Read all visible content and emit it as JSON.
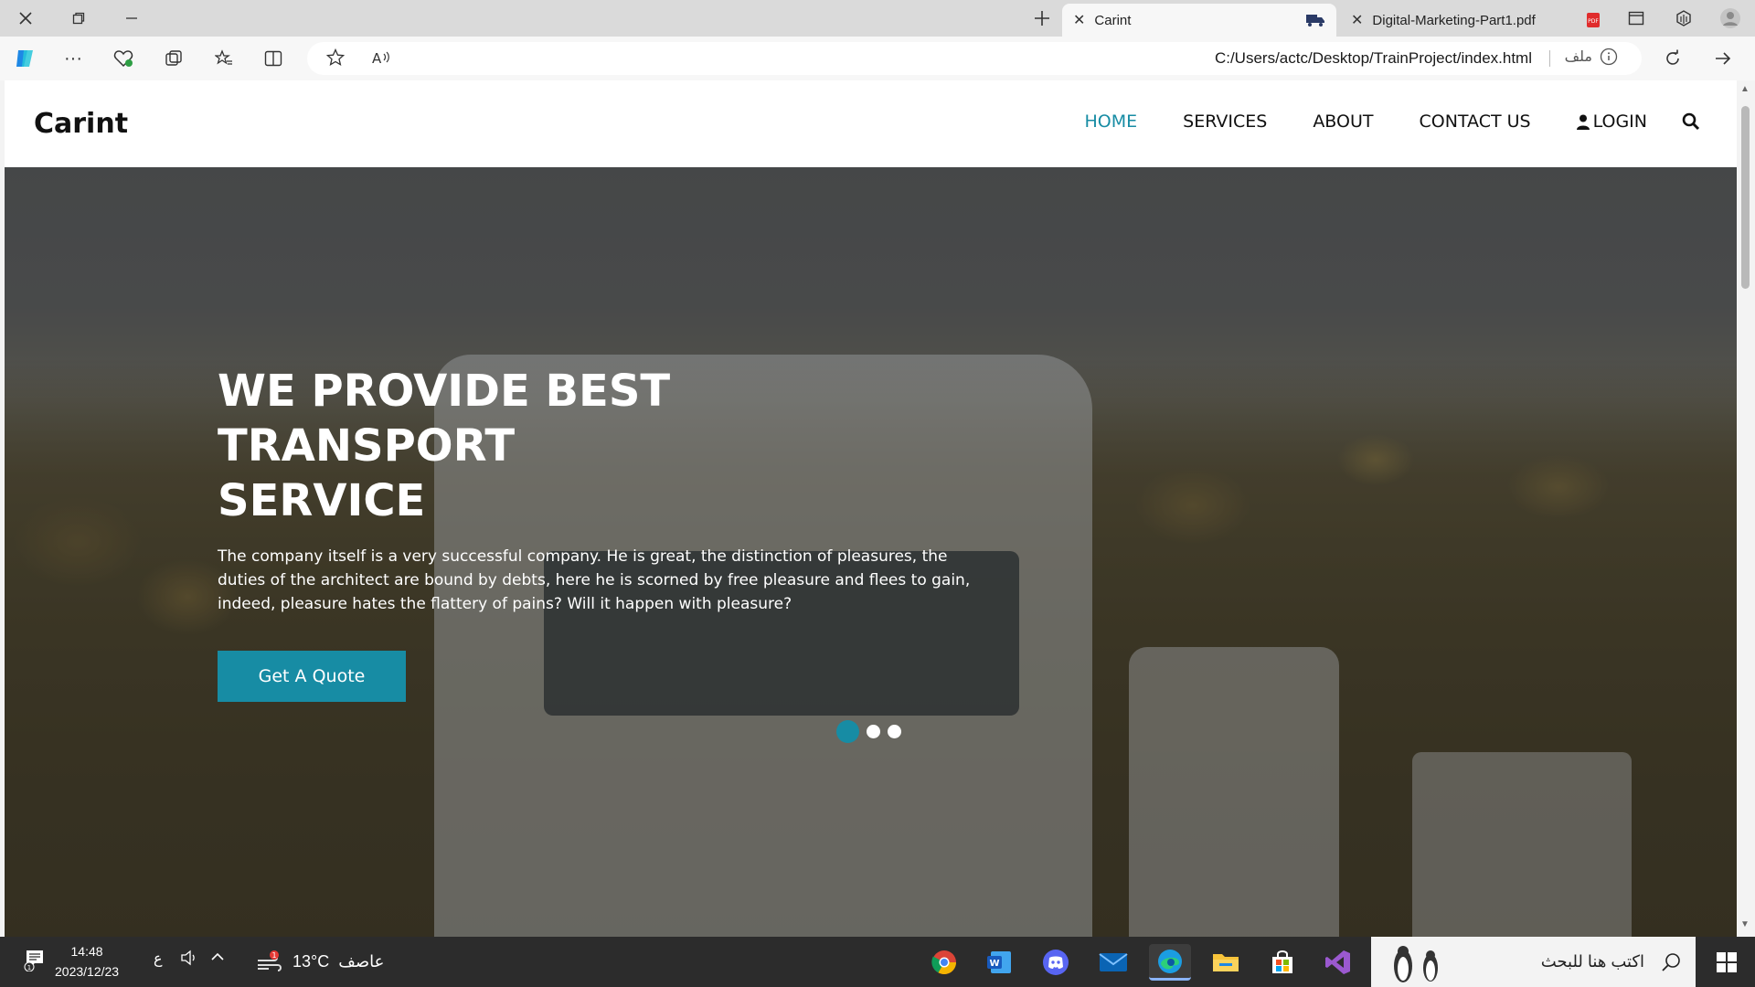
{
  "browser": {
    "tabs": [
      {
        "title": "Carint",
        "active": true
      },
      {
        "title": "Digital-Marketing-Part1.pdf",
        "active": false
      }
    ],
    "address": {
      "url": "C:/Users/actc/Desktop/TrainProject/index.html",
      "site_info_label": "ملف"
    }
  },
  "site": {
    "brand": "Carint",
    "nav": {
      "home": "HOME",
      "services": "SERVICES",
      "about": "ABOUT",
      "contact": "CONTACT US",
      "login": "LOGIN"
    },
    "hero": {
      "title": "WE PROVIDE BEST TRANSPORT SERVICE",
      "text": "The company itself is a very successful company. He is great, the distinction of pleasures, the duties of the architect are bound by debts, here he is scorned by free pleasure and flees to gain, indeed, pleasure hates the flattery of pains? Will it happen with pleasure?",
      "cta": "Get A Quote",
      "slides_total": 3,
      "active_slide": 1
    },
    "accent_color": "#178ca4"
  },
  "taskbar": {
    "time": "14:48",
    "date": "2023/12/23",
    "lang": "ع",
    "weather_temp": "13°C",
    "weather_label": "عاصف",
    "weather_badge": "1",
    "search_placeholder": "اكتب هنا للبحث"
  }
}
